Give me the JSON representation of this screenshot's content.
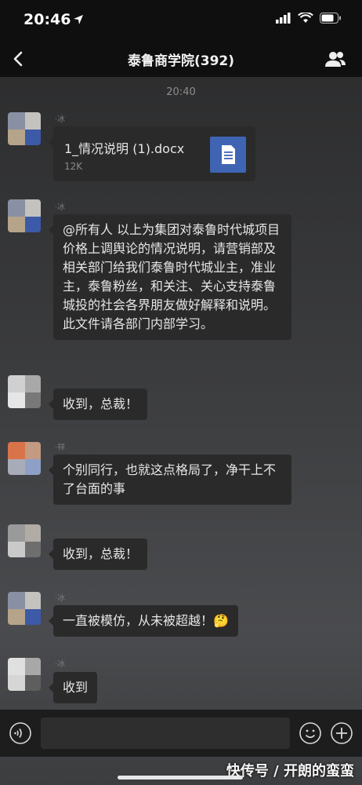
{
  "status_bar": {
    "time": "20:46"
  },
  "header": {
    "title": "泰鲁商学院(392)"
  },
  "chat": {
    "timestamp": "20:40",
    "messages": [
      {
        "type": "file",
        "file_name": "1_情况说明 (1).docx",
        "file_size": "12K"
      },
      {
        "type": "text",
        "text": "@所有人  以上为集团对泰鲁时代城项目价格上调舆论的情况说明，请营销部及相关部门给我们泰鲁时代城业主，准业主，泰鲁粉丝，和关注、关心支持泰鲁城投的社会各界朋友做好解释和说明。此文件请各部门内部学习。"
      },
      {
        "type": "text",
        "text": "收到，总裁！"
      },
      {
        "type": "text",
        "text": "个别同行，也就这点格局了，净干上不了台面的事"
      },
      {
        "type": "text",
        "text": "收到，总裁！"
      },
      {
        "type": "text",
        "text": "一直被模仿，从未被超越！🤔"
      },
      {
        "type": "text",
        "text": "收到"
      }
    ]
  },
  "watermark": {
    "text": "快传号 / 开朗的蛮蛮"
  },
  "colors": {
    "file_icon": "#3f64b3",
    "bubble": "#2a2a2a",
    "bar": "#0f0f0f"
  }
}
